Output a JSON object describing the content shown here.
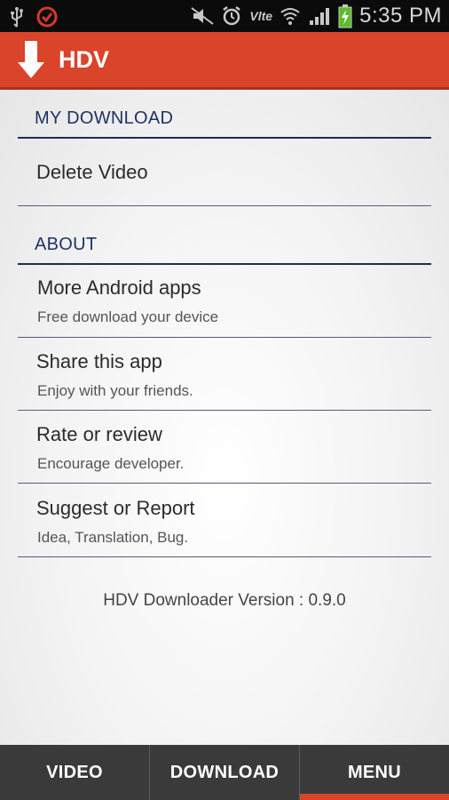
{
  "status_bar": {
    "time": "5:35 PM",
    "network": "Vlte"
  },
  "app": {
    "title": "HDV"
  },
  "sections": [
    {
      "header": "MY DOWNLOAD",
      "items": [
        {
          "title": "Delete Video"
        }
      ]
    },
    {
      "header": "ABOUT",
      "items": [
        {
          "title": "More Android apps",
          "subtitle": "Free download your device"
        },
        {
          "title": "Share this app",
          "subtitle": "Enjoy with your friends."
        },
        {
          "title": "Rate or review",
          "subtitle": "Encourage developer."
        },
        {
          "title": "Suggest or Report",
          "subtitle": "Idea, Translation, Bug."
        }
      ]
    }
  ],
  "version_text": "HDV Downloader Version : 0.9.0",
  "tabs": [
    {
      "label": "VIDEO"
    },
    {
      "label": "DOWNLOAD"
    },
    {
      "label": "MENU",
      "active": true
    }
  ],
  "colors": {
    "accent": "#d9442a",
    "header_text": "#1f3264",
    "tab_bar": "#3a3a3a"
  }
}
